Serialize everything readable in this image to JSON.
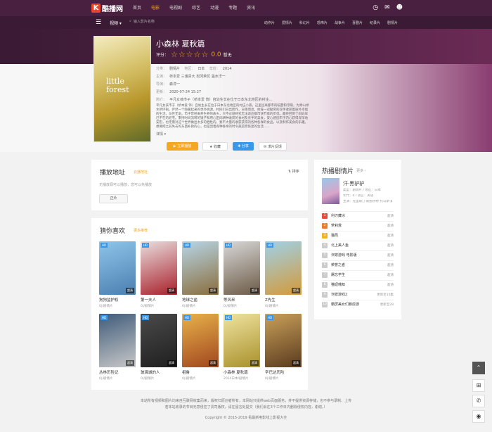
{
  "site": {
    "logo_k": "K",
    "logo_text": "酷播网"
  },
  "nav": [
    "首页",
    "电影",
    "电视剧",
    "综艺",
    "动漫",
    "专题",
    "资讯"
  ],
  "nav_active": 1,
  "top_icons": [
    "history-icon",
    "message-icon",
    "user-icon"
  ],
  "subbar": {
    "channel": "视频",
    "search_placeholder": "输入影片名称",
    "links": [
      "动作片",
      "爱情片",
      "科幻片",
      "恐怖片",
      "战争片",
      "喜剧片",
      "纪录片",
      "剧情片"
    ]
  },
  "movie": {
    "title": "小森林 夏秋篇",
    "rating_label": "评分：",
    "score": "0.0",
    "score_unit": "暂无",
    "poster_text": "little\nforest",
    "info": [
      {
        "label": "分类：",
        "value": "剧情片"
      },
      {
        "label": "地区：",
        "value": "日本"
      },
      {
        "label": "年份：",
        "value": "2014"
      },
      {
        "label": "主演：",
        "value": "桥本爱 三浦贵大 松冈茉优 温水洋一"
      },
      {
        "label": "导演：",
        "value": "森淳一"
      },
      {
        "label": "更新：",
        "value": "2020-07-24 15:27"
      },
      {
        "label": "简介：",
        "value": "平凡女孩市子（桥本爱 饰）自幼生长在位于日本东北地区的村庄..."
      }
    ],
    "intro": "平凡女孩市子（桥本爱 饰）自幼生长在位于日本东北地区的村庄小森，这里远离都市的喧嚣和浮躁，为青山绿水所环抱，俨然一个隐蔽起来的世外桃源。村民们日出而作，日落而息，依靠一双勤劳的双手收获着质朴幸福的生活。与世无争。市子曾经离开生养的故乡，只不过她终究无法适应都市快节奏的步伐，最终回到了妈妈早已不在的老宅。秉持时间流转的镜子和用心田间耕种收获的食材及亲手的美食，安心感因市子内心获得深深地安慰，也无需对这个世界做出太多的牺牲的，要不大量的收获获得的各种各样的食品，以及制作美食的乐趣。想要把之前失去的东西补救的心，也是因着各种各样的时令蔬菜而恢复的生活......",
    "more": "详情 ▾",
    "buttons": {
      "play": "▶ 立即播放",
      "fav": "★ 收藏",
      "share": "✚ 分享",
      "report": "⚑ 举报",
      "shortcut": "✉ 求片反馈"
    }
  },
  "play": {
    "title": "播放地址",
    "sub": "云播地址",
    "sort": "⇅ 排序",
    "empty": "无播放源可以播放，您可以先播放",
    "source_btn": "正片"
  },
  "guess": {
    "title": "猜你喜欢",
    "sub": "更多推荐",
    "items": [
      {
        "name": "狗狗监护权",
        "sub": "0|/剧情片",
        "tag": "HD",
        "res": "超清",
        "c1": "#8ec5ea",
        "c2": "#4b7fb0"
      },
      {
        "name": "第一夫人",
        "sub": "0|/剧情片",
        "tag": "HD",
        "res": "超清",
        "c1": "#e9dede",
        "c2": "#a8202a"
      },
      {
        "name": "地球之盐",
        "sub": "0|/剧情片",
        "tag": "HD",
        "res": "超清",
        "c1": "#b7d6e8",
        "c2": "#8a6d3b"
      },
      {
        "name": "等风来",
        "sub": "0|/剧情片",
        "tag": "HD",
        "res": "超清",
        "c1": "#d8d8d8",
        "c2": "#6c5a45"
      },
      {
        "name": "Z先生",
        "sub": "0|/剧情片",
        "tag": "HD",
        "res": "超清",
        "c1": "#9fd1e8",
        "c2": "#d39a3a"
      },
      {
        "name": "丛林历险记",
        "sub": "0|/剧情片",
        "tag": "HD",
        "res": "超清",
        "c1": "#3f5b7a",
        "c2": "#c8c8c8"
      },
      {
        "name": "玻璃城的人",
        "sub": "0|/剧情片",
        "tag": "HD",
        "res": "超清",
        "c1": "#4a4a4a",
        "c2": "#1f1f1f"
      },
      {
        "name": "祖鲁",
        "sub": "0|/剧情片",
        "tag": "HD",
        "res": "超清",
        "c1": "#e8b24a",
        "c2": "#a0461e"
      },
      {
        "name": "小森林 夏秋篇",
        "sub": "2014日本/剧情片",
        "tag": "HD",
        "res": "超清",
        "c1": "#efe3a0",
        "c2": "#a8902a"
      },
      {
        "name": "辛巴达历险",
        "sub": "0|/剧情片",
        "tag": "HD",
        "res": "超清",
        "c1": "#c9a05a",
        "c2": "#5a3a1e"
      }
    ]
  },
  "hot": {
    "title": "热播剧情片",
    "more": "更多 ›",
    "featured": {
      "title": "汗·黑驴驴",
      "info": [
        "类型：剧情片 / 地区：日本",
        "年代：0 / 语言：英语",
        "主演：克里斯汀·斯图尔特 托马斯·桑..."
      ]
    },
    "items": [
      {
        "name": "利刃藏冰",
        "tail": "超清"
      },
      {
        "name": "萝莉救",
        "tail": "超清"
      },
      {
        "name": "猫局",
        "tail": "超清"
      },
      {
        "name": "北上美人鱼",
        "tail": "超清"
      },
      {
        "name": "诈欺游戏 电影版",
        "tail": "超清"
      },
      {
        "name": "荣誉之者",
        "tail": "超清"
      },
      {
        "name": "屠忘学生",
        "tail": "超清"
      },
      {
        "name": "猫妞韩知",
        "tail": "超清"
      },
      {
        "name": "诈欺游戏2",
        "tail": "更新至10集"
      },
      {
        "name": "霸屏美女们暴虐游",
        "tail": "更新至28"
      }
    ]
  },
  "footer": {
    "line1": "本站所有视频和图片均来自互联网收集而来，版权归原创者所有，本网站只提供web页面服务，并不提供资源存储，也不参与录制、上传",
    "line2": "若本站收录的节目无意侵犯了贵司版权，请在留言处提交（我们会在3个工作日内删除侵权内容，谢谢。）",
    "copyright": "Copyright © 2015-2019 看最新电影线上影视大全"
  },
  "fab_icons": [
    "up-icon",
    "windows-icon",
    "wechat-icon",
    "weibo-icon"
  ]
}
